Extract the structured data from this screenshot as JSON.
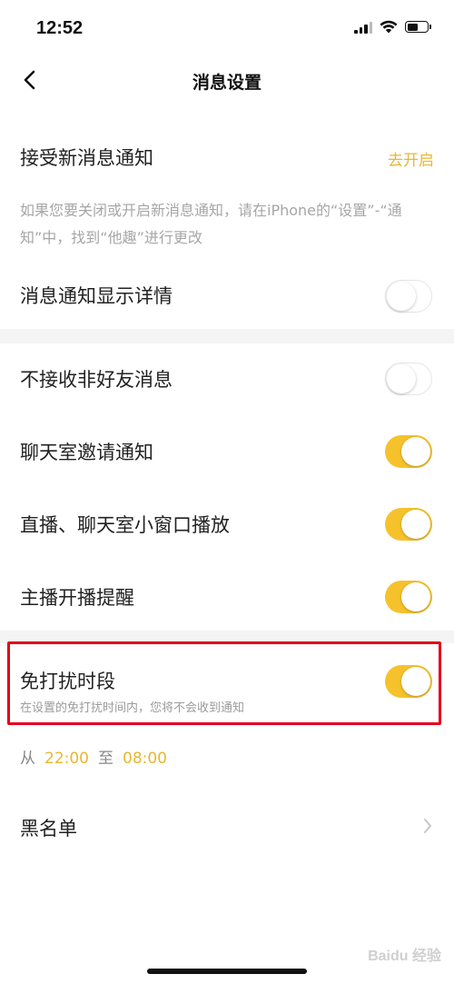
{
  "status_bar": {
    "time": "12:52"
  },
  "nav": {
    "title": "消息设置"
  },
  "new_message": {
    "label": "接受新消息通知",
    "action": "去开启",
    "hint": "如果您要关闭或开启新消息通知，请在iPhone的“设置”-“通知”中，找到“他趣”进行更改"
  },
  "show_details": {
    "label": "消息通知显示详情",
    "on": false
  },
  "settings": [
    {
      "label": "不接收非好友消息",
      "on": false
    },
    {
      "label": "聊天室邀请通知",
      "on": true
    },
    {
      "label": "直播、聊天室小窗口播放",
      "on": true
    },
    {
      "label": "主播开播提醒",
      "on": true
    }
  ],
  "dnd": {
    "label": "免打扰时段",
    "hint": "在设置的免打扰时间内，您将不会收到通知",
    "on": true,
    "from_label": "从",
    "start": "22:00",
    "to_label": "至",
    "end": "08:00"
  },
  "blacklist": {
    "label": "黑名单"
  },
  "watermark": "Baidu 经验",
  "colors": {
    "accent": "#f6c22c",
    "accent_text": "#e9b730",
    "highlight": "#e4001e",
    "band": "#f4f4f4"
  }
}
